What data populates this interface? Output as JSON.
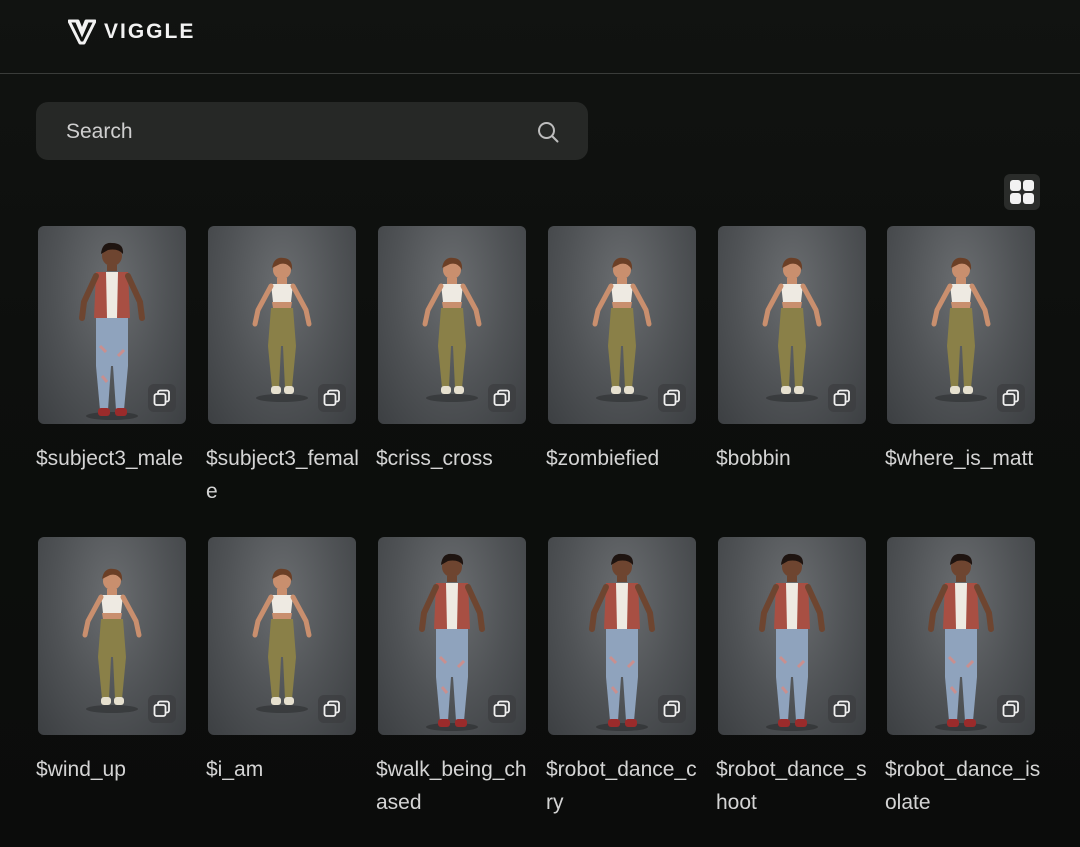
{
  "header": {
    "brand": "VIGGLE",
    "logo_icon": "viggle-v-logo-icon"
  },
  "search": {
    "placeholder": "Search",
    "value": "",
    "icon": "search-icon"
  },
  "view_toggle": {
    "icon": "grid-view-icon"
  },
  "templates": [
    {
      "label": "$subject3_male",
      "figure": "male"
    },
    {
      "label": "$subject3_female",
      "figure": "female"
    },
    {
      "label": "$criss_cross",
      "figure": "female"
    },
    {
      "label": "$zombiefied",
      "figure": "female"
    },
    {
      "label": "$bobbin",
      "figure": "female"
    },
    {
      "label": "$where_is_matt",
      "figure": "female"
    },
    {
      "label": "$wind_up",
      "figure": "female"
    },
    {
      "label": "$i_am",
      "figure": "female"
    },
    {
      "label": "$walk_being_chased",
      "figure": "male"
    },
    {
      "label": "$robot_dance_cry",
      "figure": "male"
    },
    {
      "label": "$robot_dance_shoot",
      "figure": "male"
    },
    {
      "label": "$robot_dance_isolate",
      "figure": "male"
    }
  ],
  "colors": {
    "background": "#0d0f0d",
    "search_bg": "#262826",
    "thumb_bg": "#55585b",
    "text": "#d4d4d4"
  }
}
